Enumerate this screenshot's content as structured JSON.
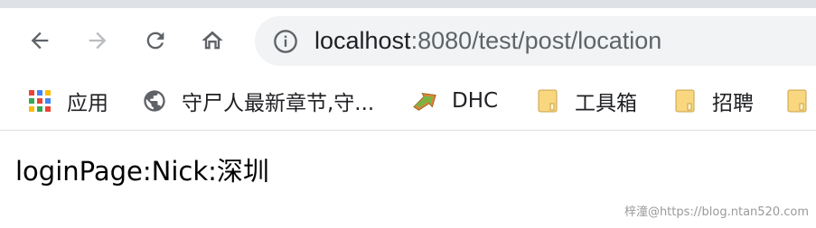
{
  "address_bar": {
    "host": "localhost",
    "path": ":8080/test/post/location"
  },
  "bookmarks": [
    {
      "label": "应用",
      "icon": "apps-grid-icon"
    },
    {
      "label": "守尸人最新章节,守...",
      "icon": "globe-icon"
    },
    {
      "label": "DHC",
      "icon": "dhc-arrow-icon"
    },
    {
      "label": "工具箱",
      "icon": "folder-icon"
    },
    {
      "label": "招聘",
      "icon": "folder-icon"
    },
    {
      "label": "",
      "icon": "folder-icon"
    }
  ],
  "page": {
    "text": "loginPage:Nick:深圳"
  },
  "watermark": "梓潼@https://blog.ntan520.com",
  "colors": {
    "tab_strip": "#dee1e6",
    "omnibox": "#f1f3f4",
    "folder": "#f9d77e"
  }
}
